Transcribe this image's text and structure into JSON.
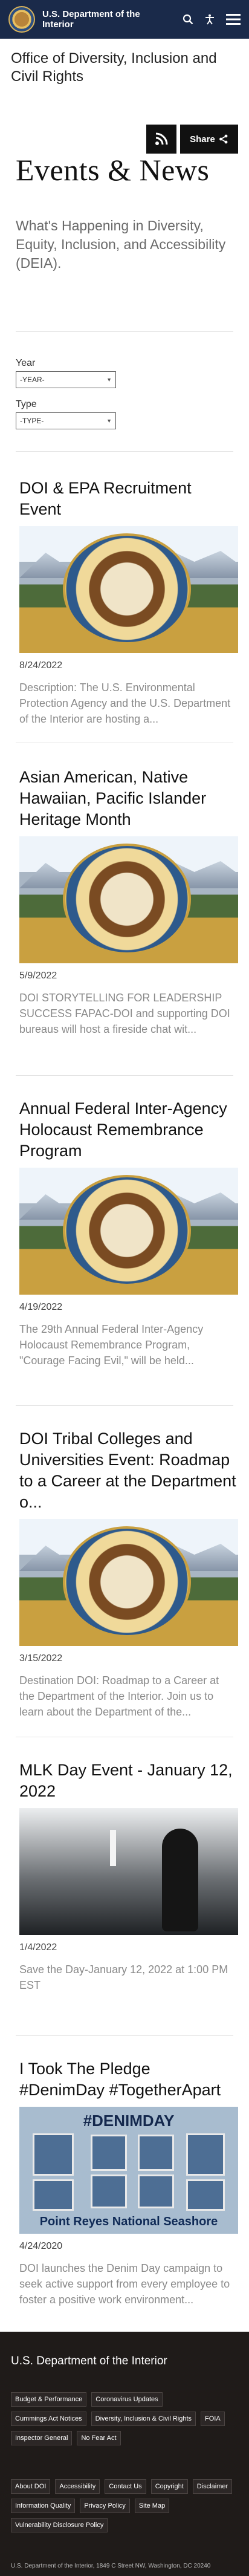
{
  "header": {
    "brand": "U.S. Department of the Interior",
    "icons": [
      "search-icon",
      "accessibility-icon",
      "menu-icon"
    ]
  },
  "office_title": "Office of Diversity, Inclusion and Civil Rights",
  "share_label": "Share",
  "page_title": "Events & News",
  "subtitle": "What's Happening in Diversity, Equity, Inclusion, and Accessibility (DEIA).",
  "filters": {
    "year_label": "Year",
    "year_value": "-YEAR-",
    "type_label": "Type",
    "type_value": "-TYPE-"
  },
  "events": [
    {
      "title": "DOI & EPA Recruitment Event",
      "date": "8/24/2022",
      "desc": "Description: The U.S. Environmental Protection Agency and the U.S. Department of the Interior are hosting a..."
    },
    {
      "title": "Asian American, Native Hawaiian, Pacific Islander Heritage Month",
      "date": "5/9/2022",
      "desc": "DOI STORYTELLING FOR LEADERSHIP SUCCESS FAPAC-DOI and supporting DOI bureaus will host a fireside chat wit..."
    },
    {
      "title": "Annual Federal Inter-Agency Holocaust Remembrance Program",
      "date": "4/19/2022",
      "desc": "The 29th Annual Federal Inter-Agency Holocaust Remembrance Program, \"Courage Facing Evil,\" will be held..."
    },
    {
      "title": "DOI Tribal Colleges and Universities Event: Roadmap to a Career at the Department o...",
      "date": "3/15/2022",
      "desc": "Destination DOI: Roadmap to a Career at the Department of the Interior. Join us to learn about the Department of the..."
    },
    {
      "title": "MLK Day Event - January 12, 2022",
      "date": "1/4/2022",
      "desc": "Save the Day-January 12, 2022 at 1:00 PM EST"
    },
    {
      "title": "I Took The Pledge #DenimDay #TogetherApart",
      "date": "4/24/2020",
      "desc": "DOI launches the Denim Day campaign to seek active support from every employee to foster a positive work environment..."
    }
  ],
  "denim_image": {
    "tag": "#DENIMDAY",
    "caption": "Point Reyes National Seashore"
  },
  "footer": {
    "title": "U.S. Department of the Interior",
    "links_primary": [
      "Budget & Performance",
      "Coronavirus Updates",
      "Cummings Act Notices",
      "Diversity, Inclusion & Civil Rights",
      "FOIA",
      "Inspector General",
      "No Fear Act"
    ],
    "links_secondary": [
      "About DOI",
      "Accessibility",
      "Contact Us",
      "Copyright",
      "Disclaimer",
      "Information Quality",
      "Privacy Policy",
      "Site Map",
      "Vulnerability Disclosure Policy"
    ],
    "address": "U.S. Department of the Interior, 1849 C Street NW, Washington, DC 20240"
  },
  "colors": {
    "header_bg": "#1a2a4a",
    "footer_bg": "#1f1b19",
    "button_bg": "#111111"
  }
}
